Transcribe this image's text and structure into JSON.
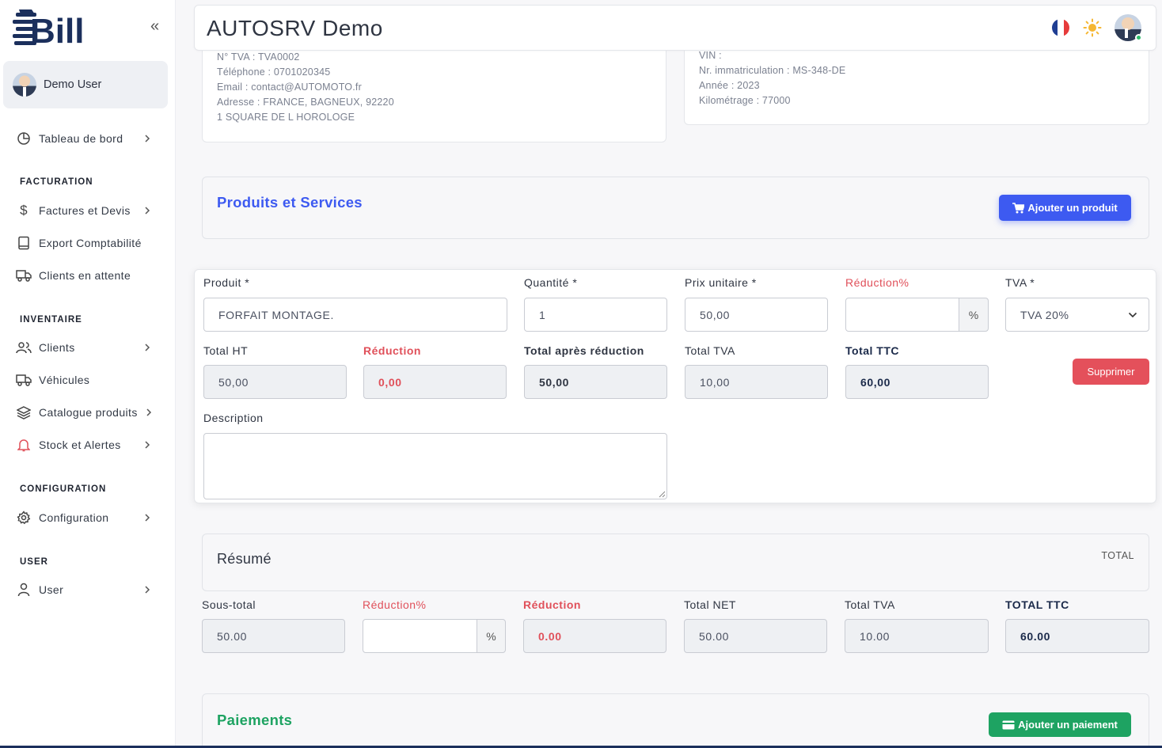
{
  "brand": {
    "logo_text": "Bill"
  },
  "sidebar": {
    "user_name": "Demo User",
    "dashboard": "Tableau de bord",
    "sections": {
      "facturation": "FACTURATION",
      "inventaire": "INVENTAIRE",
      "configuration": "CONFIGURATION",
      "user": "USER"
    },
    "items": {
      "factures": "Factures et Devis",
      "export": "Export Comptabilité",
      "clients_attente": "Clients en attente",
      "clients": "Clients",
      "vehicules": "Véhicules",
      "catalogue": "Catalogue produits",
      "stock": "Stock et Alertes",
      "configuration": "Configuration",
      "user": "User"
    }
  },
  "header": {
    "title": "AUTOSRV Demo"
  },
  "client_info": {
    "tva": "N° TVA : TVA0002",
    "phone": "Téléphone : 0701020345",
    "email": "Email : contact@AUTOMOTO.fr",
    "address": "Adresse : FRANCE, BAGNEUX, 92220",
    "street": "1 SQUARE DE L HOROLOGE"
  },
  "vehicle_info": {
    "vin": "VIN :",
    "plate": "Nr. immatriculation : MS-348-DE",
    "year": "Année : 2023",
    "mileage": "Kilométrage : 77000"
  },
  "products": {
    "title": "Produits et Services",
    "add_button": "Ajouter un produit"
  },
  "product_row": {
    "labels": {
      "product": "Produit *",
      "quantity": "Quantité *",
      "unit_price": "Prix unitaire *",
      "reduction_pct": "Réduction%",
      "tva": "TVA *",
      "total_ht": "Total HT",
      "reduction": "Réduction",
      "total_after": "Total après réduction",
      "total_tva": "Total TVA",
      "total_ttc": "Total TTC",
      "description": "Description"
    },
    "values": {
      "product": "FORFAIT MONTAGE.",
      "quantity": "1",
      "unit_price": "50,00",
      "reduction_pct": "",
      "percent_symbol": "%",
      "tva": "TVA 20%",
      "total_ht": "50,00",
      "reduction": "0,00",
      "total_after": "50,00",
      "total_tva": "10,00",
      "total_ttc": "60,00"
    },
    "delete_button": "Supprimer"
  },
  "summary": {
    "title": "Résumé",
    "total_label": "TOTAL",
    "labels": {
      "subtotal": "Sous-total",
      "reduction_pct": "Réduction%",
      "reduction": "Réduction",
      "total_net": "Total NET",
      "total_tva": "Total TVA",
      "total_ttc": "TOTAL TTC"
    },
    "values": {
      "subtotal": "50.00",
      "reduction_pct": "",
      "percent_symbol": "%",
      "reduction": "0.00",
      "total_net": "50.00",
      "total_tva": "10.00",
      "total_ttc": "60.00"
    }
  },
  "payments": {
    "title": "Paiements",
    "add_button": "Ajouter un paiement"
  },
  "colors": {
    "primary": "#3d5af1",
    "danger": "#e4505b",
    "success": "#1ea362",
    "navy": "#1b2a4a",
    "flag_blue": "#1f3e93",
    "flag_red": "#e63b3b",
    "sun": "#f5b733"
  }
}
